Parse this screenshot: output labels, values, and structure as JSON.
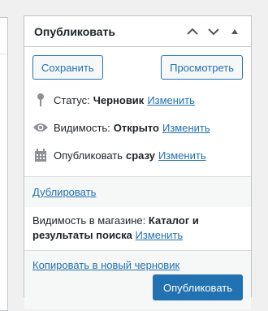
{
  "panel": {
    "title": "Опубликовать"
  },
  "actions": {
    "save_label": "Сохранить",
    "preview_label": "Просмотреть"
  },
  "status": {
    "icon": "pin-icon",
    "label": "Статус:",
    "value": "Черновик",
    "edit_label": "Изменить"
  },
  "visibility": {
    "icon": "eye-icon",
    "label": "Видимость:",
    "value": "Открыто",
    "edit_label": "Изменить"
  },
  "publish_time": {
    "icon": "calendar-icon",
    "label": "Опубликовать",
    "value": "сразу",
    "edit_label": "Изменить"
  },
  "duplicate": {
    "label": "Дублировать"
  },
  "catalog_visibility": {
    "label": "Видимость в магазине:",
    "value": "Каталог и результаты поиска",
    "edit_label": "Изменить"
  },
  "footer": {
    "copy_draft_label": "Копировать в новый черновик",
    "publish_label": "Опубликовать"
  },
  "colors": {
    "accent": "#2271b1",
    "border": "#c3c4c7",
    "icon_gray": "#8c8f94"
  }
}
